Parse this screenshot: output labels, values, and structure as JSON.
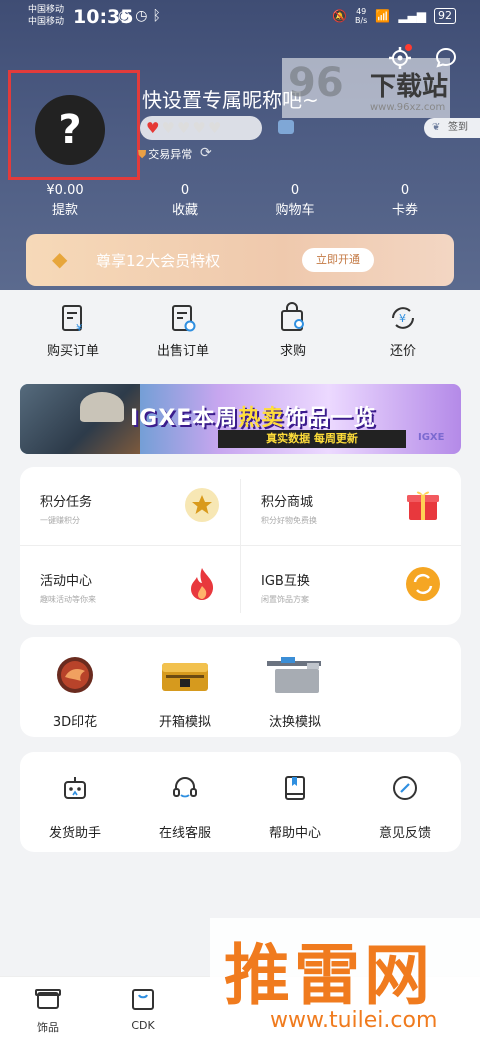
{
  "status_bar": {
    "carrier_1": "中国移动",
    "carrier_2": "中国移动",
    "time": "10:35",
    "speed_value": "49",
    "speed_unit": "B/s",
    "battery": "92"
  },
  "profile": {
    "avatar_glyph": "?",
    "nickname": "快设置专属昵称吧~",
    "trade_status": "交易异常",
    "signin_label": "签到",
    "hearts_total": 5,
    "hearts_filled": 1
  },
  "stats": [
    {
      "value": "¥0.00",
      "label": "提款"
    },
    {
      "value": "0",
      "label": "收藏"
    },
    {
      "value": "0",
      "label": "购物车"
    },
    {
      "value": "0",
      "label": "卡券"
    }
  ],
  "vip": {
    "text": "尊享12大会员特权",
    "button": "立即开通"
  },
  "quick_actions": [
    {
      "label": "购买订单",
      "icon": "buy-order-icon"
    },
    {
      "label": "出售订单",
      "icon": "sell-order-icon"
    },
    {
      "label": "求购",
      "icon": "wanted-bag-icon"
    },
    {
      "label": "还价",
      "icon": "bargain-icon"
    }
  ],
  "banner": {
    "title_a": "IGXE本周",
    "title_b": "热卖",
    "title_c": "饰品一览",
    "subtitle": "真实数据  每周更新",
    "logo": "IGXE"
  },
  "features": [
    {
      "title": "积分任务",
      "subtitle": "一键赚积分",
      "icon": "star-coin-icon"
    },
    {
      "title": "积分商城",
      "subtitle": "积分好物免费换",
      "icon": "gift-box-icon"
    },
    {
      "title": "活动中心",
      "subtitle": "趣味活动等你来",
      "icon": "flame-icon"
    },
    {
      "title": "IGB互换",
      "subtitle": "闲置饰品方案",
      "icon": "exchange-icon"
    }
  ],
  "skins": [
    {
      "label": "3D印花",
      "icon": "sticker-icon"
    },
    {
      "label": "开箱模拟",
      "icon": "case-icon"
    },
    {
      "label": "汰换模拟",
      "icon": "rifle-icon"
    }
  ],
  "tools": [
    {
      "label": "发货助手",
      "icon": "robot-icon"
    },
    {
      "label": "在线客服",
      "icon": "headset-icon"
    },
    {
      "label": "帮助中心",
      "icon": "book-icon"
    },
    {
      "label": "意见反馈",
      "icon": "pen-icon"
    }
  ],
  "bottom_nav": [
    {
      "label": "饰品",
      "icon": "box-icon"
    },
    {
      "label": "CDK",
      "icon": "bag-icon"
    }
  ],
  "watermarks": {
    "site_96_num": "96",
    "site_96_text": "下载站",
    "site_96_url": "www.96xz.com",
    "tuilei_text": "推雷网",
    "tuilei_url": "www.tuilei.com"
  },
  "colors": {
    "header": "#3f4d74",
    "accent_orange": "#f07b1e",
    "vip_gold": "#e7a63b",
    "alert_red": "#e53935"
  }
}
